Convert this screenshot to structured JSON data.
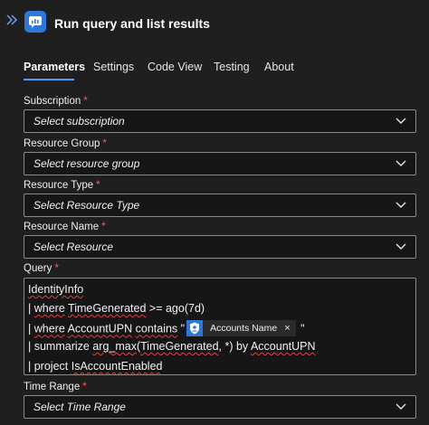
{
  "header": {
    "title": "Run query and list results",
    "expand_icon": "double-chevron-right-icon",
    "app_icon": "log-analytics-icon"
  },
  "tabs": [
    {
      "label": "Parameters",
      "active": true
    },
    {
      "label": "Settings",
      "active": false
    },
    {
      "label": "Code View",
      "active": false
    },
    {
      "label": "Testing",
      "active": false
    },
    {
      "label": "About",
      "active": false
    }
  ],
  "fields": {
    "subscription": {
      "label": "Subscription",
      "required_mark": "*",
      "value": "Select subscription"
    },
    "resource_group": {
      "label": "Resource Group",
      "required_mark": "*",
      "value": "Select resource group"
    },
    "resource_type": {
      "label": "Resource Type",
      "required_mark": "*",
      "value": "Select Resource Type"
    },
    "resource_name": {
      "label": "Resource Name",
      "required_mark": "*",
      "value": "Select Resource"
    },
    "query": {
      "label": "Query",
      "required_mark": "*",
      "lines": {
        "l1": "IdentityInfo",
        "l2_prefix": "| ",
        "l2_a": "where",
        "l2_sp": " ",
        "l2_b": "TimeGenerated",
        "l2_c": " >= ago(7d)",
        "l3_prefix": "| ",
        "l3_a": "where",
        "l3_sp": " ",
        "l3_b": "AccountUPN",
        "l3_sp2": " ",
        "l3_c": "contains",
        "l3_open": " \"",
        "l3_close": " \"",
        "l4_prefix": "| summarize ",
        "l4_a": "arg_max",
        "l4_b": "(",
        "l4_c": "TimeGenerated",
        "l4_d": ", *) by ",
        "l4_e": "AccountUPN",
        "l5_prefix": "| project ",
        "l5_a": "IsAccountEnabled"
      },
      "token": {
        "label": "Accounts Name",
        "remove": "×",
        "icon": "shield-user-icon"
      }
    },
    "time_range": {
      "label": "Time Range",
      "required_mark": "*",
      "value": "Select Time Range"
    }
  },
  "colors": {
    "accent": "#4a9cff",
    "required": "#ff5c5c",
    "token_icon_bg": "#2f78d8"
  }
}
